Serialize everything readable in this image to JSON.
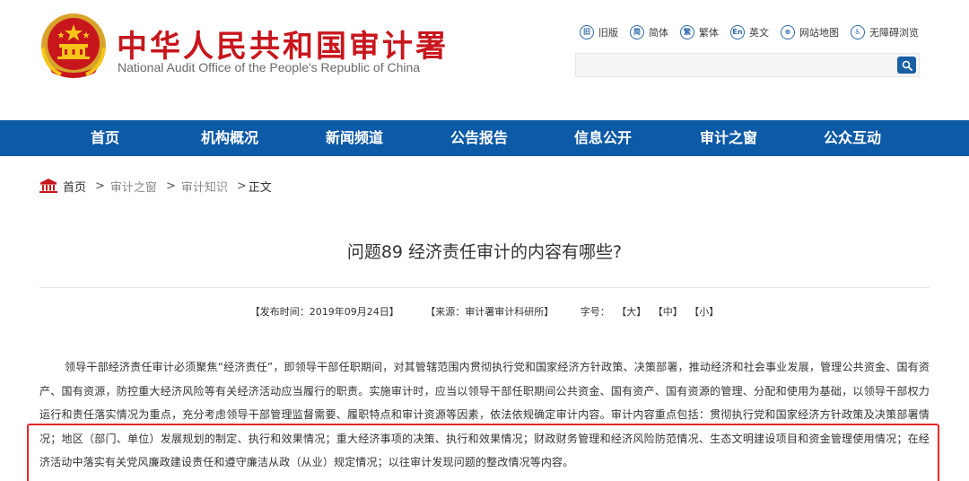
{
  "header": {
    "title_cn": "中华人民共和国审计署",
    "title_en": "National Audit Office of the People's Republic of China",
    "links": [
      {
        "label": "旧版",
        "icon": "old-version-icon"
      },
      {
        "label": "简体",
        "icon": "simplified-icon"
      },
      {
        "label": "繁体",
        "icon": "traditional-icon"
      },
      {
        "label": "英文",
        "icon": "english-icon"
      },
      {
        "label": "网站地图",
        "icon": "sitemap-icon"
      },
      {
        "label": "无障碍浏览",
        "icon": "accessibility-icon"
      }
    ],
    "search_placeholder": ""
  },
  "nav": {
    "items": [
      "首页",
      "机构概况",
      "新闻频道",
      "公告报告",
      "信息公开",
      "审计之窗",
      "公众互动"
    ]
  },
  "breadcrumb": {
    "home": "首页",
    "level1": "审计之窗",
    "level2": "审计知识",
    "current": "正文",
    "separator": ">"
  },
  "article": {
    "title": "问题89 经济责任审计的内容有哪些?",
    "publish_time": "【发布时间：2019年09月24日】",
    "source": "【来源：审计署审计科研所】",
    "font_size_label": "字号：",
    "font_sizes": [
      "【大】",
      "【中】",
      "【小】"
    ],
    "body": "领导干部经济责任审计必须聚焦“经济责任”，即领导干部任职期间，对其管辖范围内贯彻执行党和国家经济方针政策、决策部署，推动经济和社会事业发展，管理公共资金、国有资产、国有资源，防控重大经济风险等有关经济活动应当履行的职责。实施审计时，应当以领导干部任职期间公共资金、国有资产、国有资源的管理、分配和使用为基础，以领导干部权力运行和责任落实情况为重点，充分考虑领导干部管理监督需要、履职特点和审计资源等因素，依法依规确定审计内容。审计内容重点包括：贯彻执行党和国家经济方针政策及决策部署情况；地区（部门、单位）发展规划的制定、执行和效果情况；重大经济事项的决策、执行和效果情况；财政财务管理和经济风险防范情况、生态文明建设项目和资金管理使用情况；在经济活动中落实有关党风廉政建设责任和遵守廉洁从政（从业）规定情况；以往审计发现问题的整改情况等内容。"
  },
  "colors": {
    "brand_red": "#c8161d",
    "nav_blue": "#0d5aa7",
    "highlight_red": "#e8262a"
  }
}
